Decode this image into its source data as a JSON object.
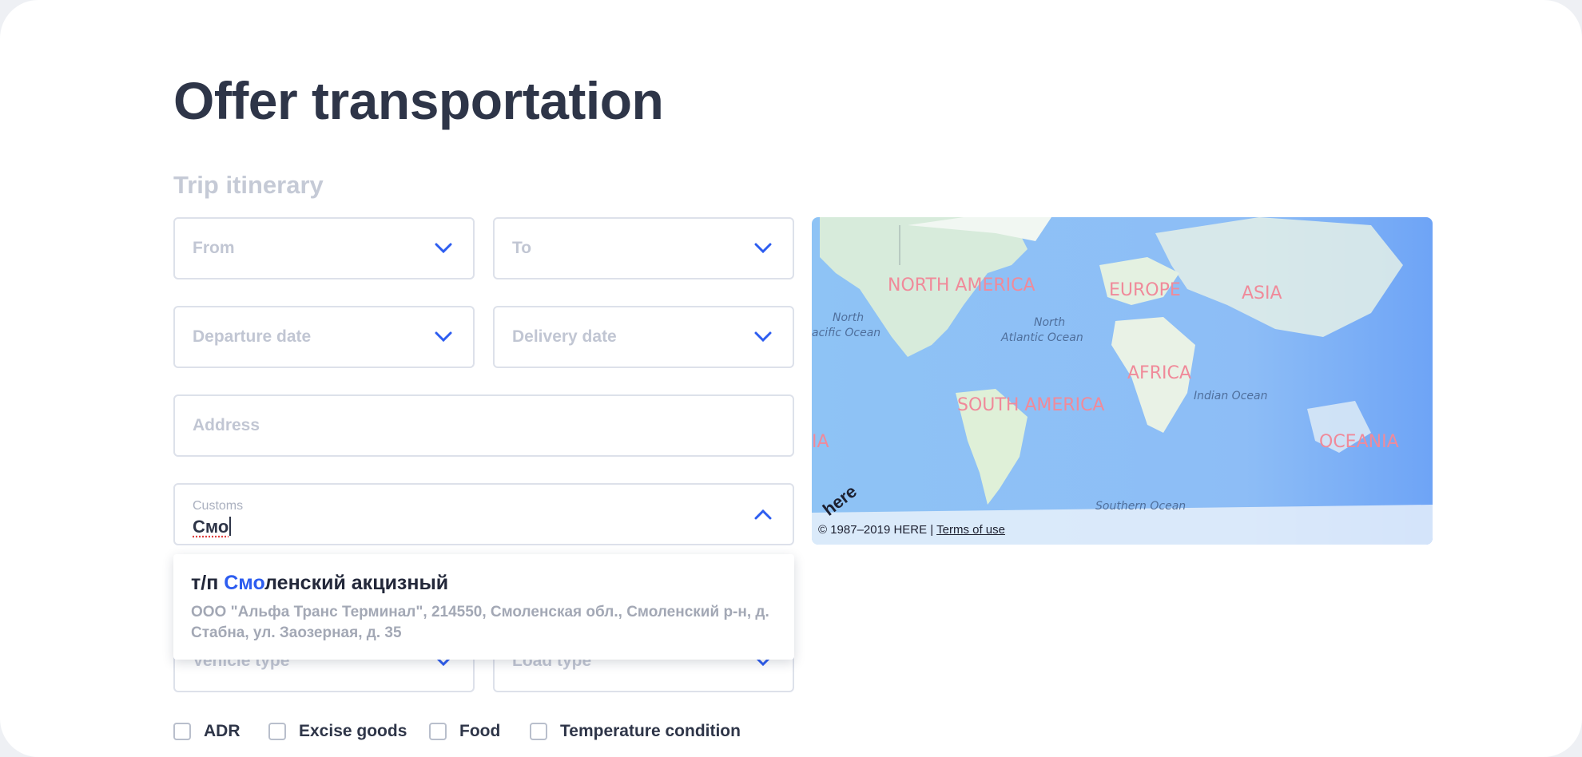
{
  "page": {
    "title": "Offer transportation"
  },
  "itinerary": {
    "section_title": "Trip itinerary",
    "from_placeholder": "From",
    "to_placeholder": "To",
    "departure_placeholder": "Departure date",
    "delivery_placeholder": "Delivery date",
    "address_placeholder": "Address"
  },
  "customs": {
    "label": "Customs",
    "value": "Смо",
    "suggestion": {
      "prefix": "т/п ",
      "match": "Смо",
      "rest": "ленский акцизный",
      "details": "ООО \"Альфа Транс Терминал\", 214550, Смоленская обл., Смоленский р-н, д. Стабна, ул. Заозерная, д. 35"
    }
  },
  "vehicle": {
    "vehicle_type_placeholder": "Vehicle type",
    "load_type_placeholder": "Load type"
  },
  "checkboxes": [
    {
      "label": "ADR",
      "checked": false
    },
    {
      "label": "Excise goods",
      "checked": false
    },
    {
      "label": "Food",
      "checked": false
    },
    {
      "label": "Temperature condition",
      "checked": false
    }
  ],
  "map": {
    "continents": [
      "NORTH AMERICA",
      "EUROPE",
      "ASIA",
      "AFRICA",
      "SOUTH AMERICA",
      "OCEANIA",
      "IA"
    ],
    "oceans": [
      "North",
      "acific Ocean",
      "North",
      "Atlantic Ocean",
      "Indian Ocean",
      "Southern Ocean"
    ],
    "logo": "here",
    "copyright": "© 1987–2019 HERE | ",
    "terms_link": "Terms of use"
  },
  "colors": {
    "accent": "#2d5df0",
    "title": "#2e3548",
    "placeholder": "#c1c6d3"
  }
}
